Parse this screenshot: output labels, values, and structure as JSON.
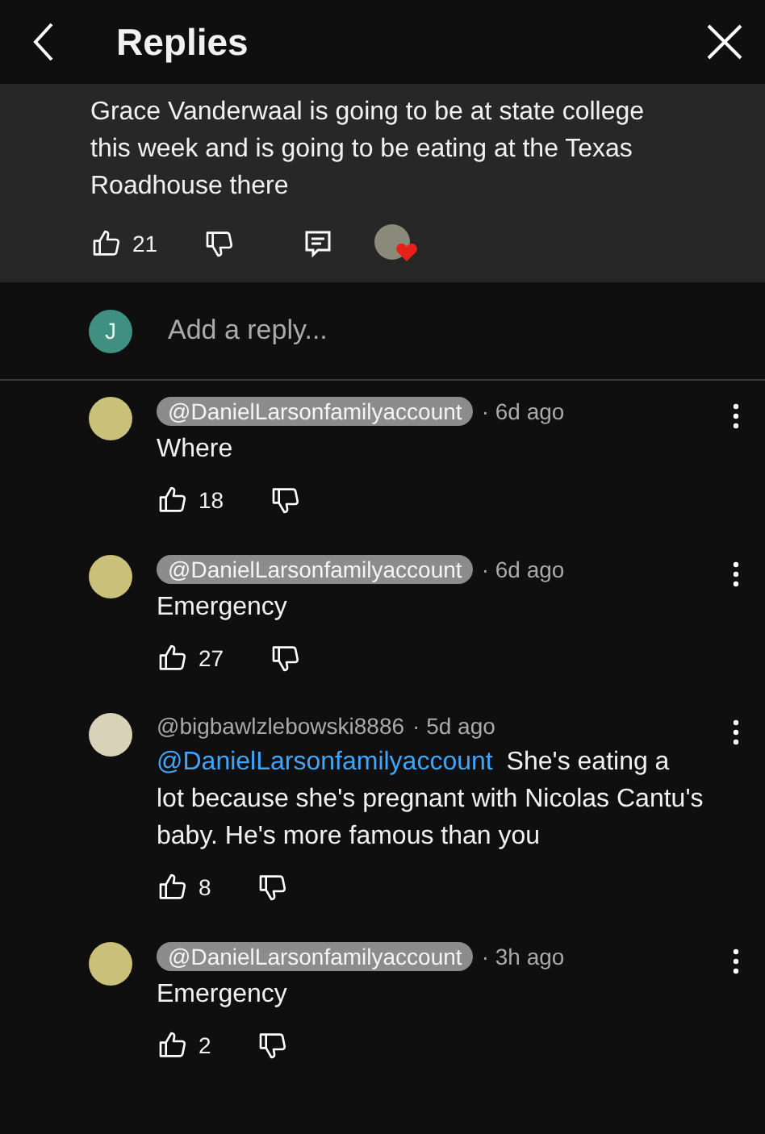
{
  "header": {
    "title": "Replies"
  },
  "parent": {
    "text": "Grace Vanderwaal is going to be at state college this week and is going to be eating at the Texas Roadhouse there",
    "likes": "21",
    "hearted": true
  },
  "composer": {
    "avatar_letter": "J",
    "placeholder": "Add a reply..."
  },
  "replies": [
    {
      "author": "@DanielLarsonfamilyaccount",
      "owner": true,
      "time": "· 6d ago",
      "text": "Where",
      "likes": "18"
    },
    {
      "author": "@DanielLarsonfamilyaccount",
      "owner": true,
      "time": "· 6d ago",
      "text": "Emergency",
      "likes": "27"
    },
    {
      "author": "@bigbawlzlebowski8886",
      "owner": false,
      "time": "· 5d ago",
      "mention": "@DanielLarsonfamilyaccount",
      "text": "She's eating a lot because she's pregnant with Nicolas Cantu's baby. He's more famous than you",
      "likes": "8"
    },
    {
      "author": "@DanielLarsonfamilyaccount",
      "owner": true,
      "time": "· 3h ago",
      "text": "Emergency",
      "likes": "2"
    }
  ]
}
